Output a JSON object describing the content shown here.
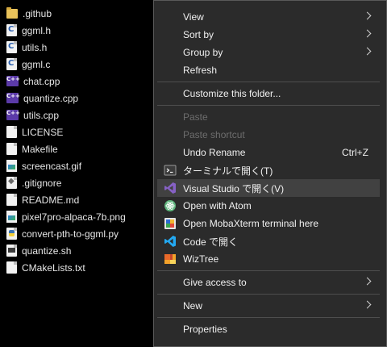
{
  "files": [
    {
      "name": ".github",
      "icon": "folder-icon"
    },
    {
      "name": "ggml.h",
      "icon": "c-header-file-icon"
    },
    {
      "name": "utils.h",
      "icon": "c-header-file-icon"
    },
    {
      "name": "ggml.c",
      "icon": "c-source-file-icon"
    },
    {
      "name": "chat.cpp",
      "icon": "cpp-file-icon"
    },
    {
      "name": "quantize.cpp",
      "icon": "cpp-file-icon"
    },
    {
      "name": "utils.cpp",
      "icon": "cpp-file-icon"
    },
    {
      "name": "LICENSE",
      "icon": "document-icon"
    },
    {
      "name": "Makefile",
      "icon": "document-icon"
    },
    {
      "name": "screencast.gif",
      "icon": "image-file-icon"
    },
    {
      "name": ".gitignore",
      "icon": "git-file-icon"
    },
    {
      "name": "README.md",
      "icon": "document-icon"
    },
    {
      "name": "pixel7pro-alpaca-7b.png",
      "icon": "image-file-icon"
    },
    {
      "name": "convert-pth-to-ggml.py",
      "icon": "python-file-icon"
    },
    {
      "name": "quantize.sh",
      "icon": "shell-script-icon"
    },
    {
      "name": "CMakeLists.txt",
      "icon": "document-icon"
    }
  ],
  "menu": {
    "view": "View",
    "sort_by": "Sort by",
    "group_by": "Group by",
    "refresh": "Refresh",
    "customize": "Customize this folder...",
    "paste": "Paste",
    "paste_shortcut": "Paste shortcut",
    "undo_rename": "Undo Rename",
    "undo_rename_shortcut": "Ctrl+Z",
    "open_terminal": "ターミナルで開く(T)",
    "open_vs": "Visual Studio で開く(V)",
    "open_atom": "Open with Atom",
    "open_mobaxterm": "Open MobaXterm terminal here",
    "open_code": "Code で開く",
    "wiztree": "WizTree",
    "give_access": "Give access to",
    "new": "New",
    "properties": "Properties"
  },
  "colors": {
    "background": "#000000",
    "menu_bg": "#2b2b2b",
    "highlight": "#414141",
    "vs_purple": "#8661c5",
    "vscode_blue": "#23a9f2"
  }
}
